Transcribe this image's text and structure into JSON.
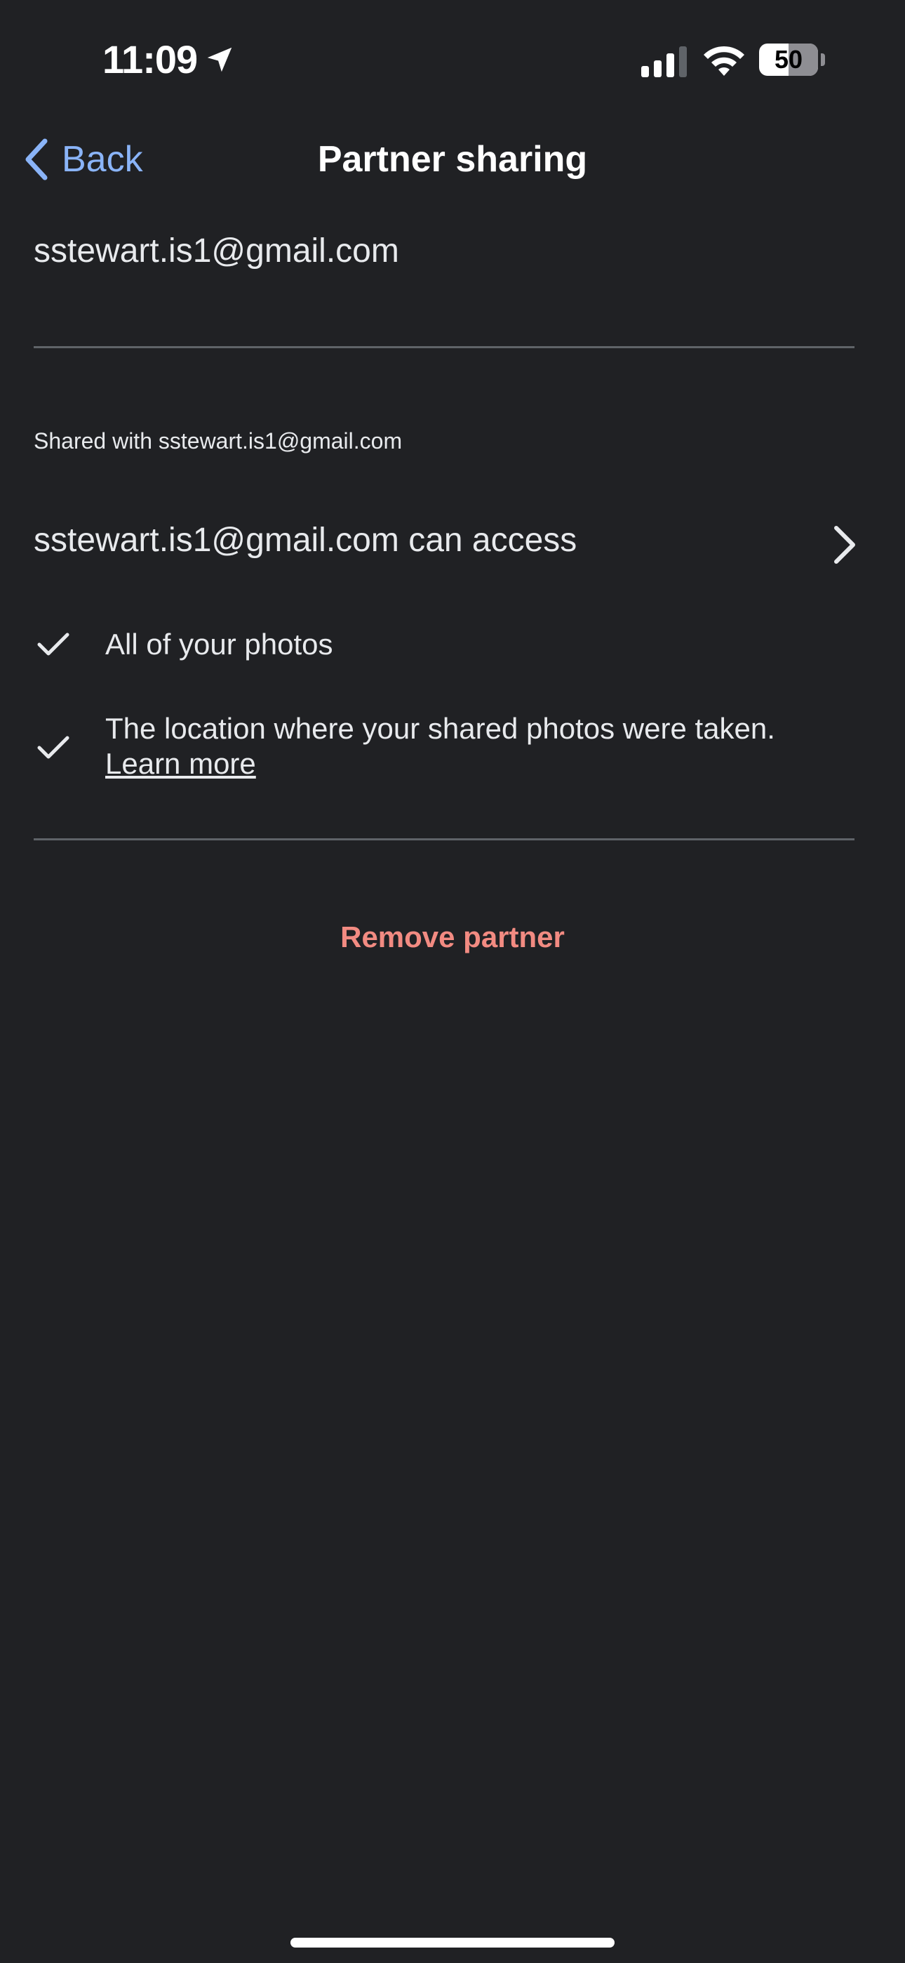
{
  "status_bar": {
    "time": "11:09",
    "battery_percent": "50",
    "battery_level": 0.5,
    "icons": [
      "location-arrow-icon",
      "cellular-signal-icon",
      "wifi-icon",
      "battery-icon"
    ]
  },
  "nav": {
    "back_label": "Back",
    "title": "Partner sharing"
  },
  "partner": {
    "email": "sstewart.is1@gmail.com"
  },
  "sharing": {
    "section_label": "Shared with sstewart.is1@gmail.com",
    "access_label": "sstewart.is1@gmail.com can access",
    "items": [
      {
        "text": "All of your photos"
      },
      {
        "text": "The location where your shared photos were taken.",
        "link": "Learn more"
      }
    ]
  },
  "actions": {
    "remove_label": "Remove partner"
  },
  "colors": {
    "background": "#202124",
    "accent_link": "#8ab4f8",
    "danger": "#f28b82",
    "divider": "#5f6368",
    "text": "#e8eaed"
  }
}
